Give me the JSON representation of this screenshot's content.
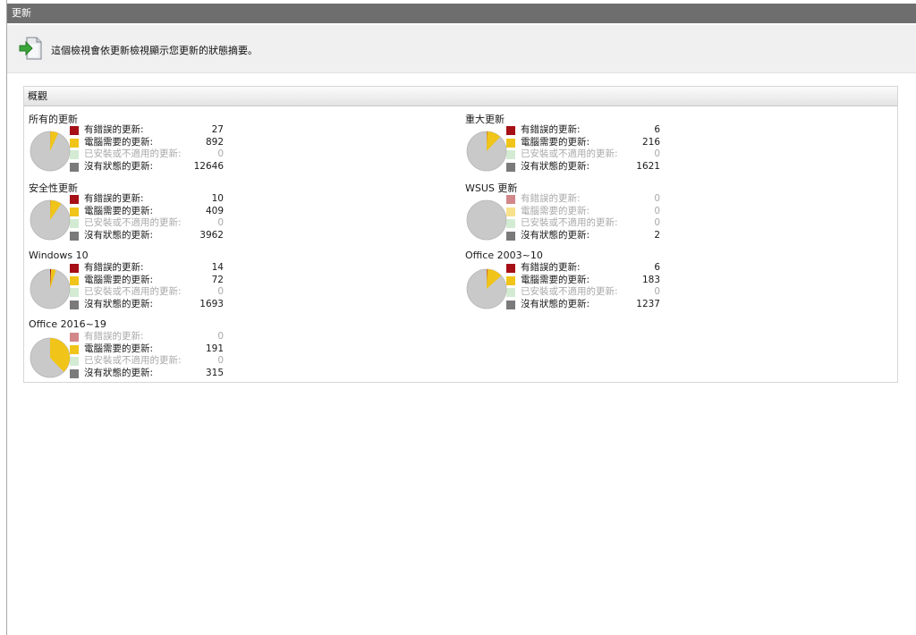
{
  "window": {
    "title": "更新"
  },
  "info": {
    "text": "這個檢視會依更新檢視顯示您更新的狀態摘要。",
    "icon": "update-arrow-page-icon"
  },
  "overview": {
    "title": "概觀"
  },
  "colors": {
    "error": "#a50f15",
    "needed": "#f0c419",
    "installed": "#a8d8a8",
    "no_status": "#7a7a7a",
    "pie_base": "#c9c9c9"
  },
  "status_labels": {
    "error": "有錯誤的更新:",
    "needed": "電腦需要的更新:",
    "installed": "已安裝或不適用的更新:",
    "no_status": "沒有狀態的更新:"
  },
  "groups": [
    {
      "title": "所有的更新",
      "error": "27",
      "needed": "892",
      "installed": "0",
      "no_status": "12646"
    },
    {
      "title": "重大更新",
      "error": "6",
      "needed": "216",
      "installed": "0",
      "no_status": "1621"
    },
    {
      "title": "安全性更新",
      "error": "10",
      "needed": "409",
      "installed": "0",
      "no_status": "3962"
    },
    {
      "title": "WSUS 更新",
      "error": "0",
      "needed": "0",
      "installed": "0",
      "no_status": "2"
    },
    {
      "title": "Windows 10",
      "error": "14",
      "needed": "72",
      "installed": "0",
      "no_status": "1693"
    },
    {
      "title": "Office 2003~10",
      "error": "6",
      "needed": "183",
      "installed": "0",
      "no_status": "1237"
    },
    {
      "title": "Office 2016~19",
      "error": "0",
      "needed": "191",
      "installed": "0",
      "no_status": "315"
    }
  ]
}
